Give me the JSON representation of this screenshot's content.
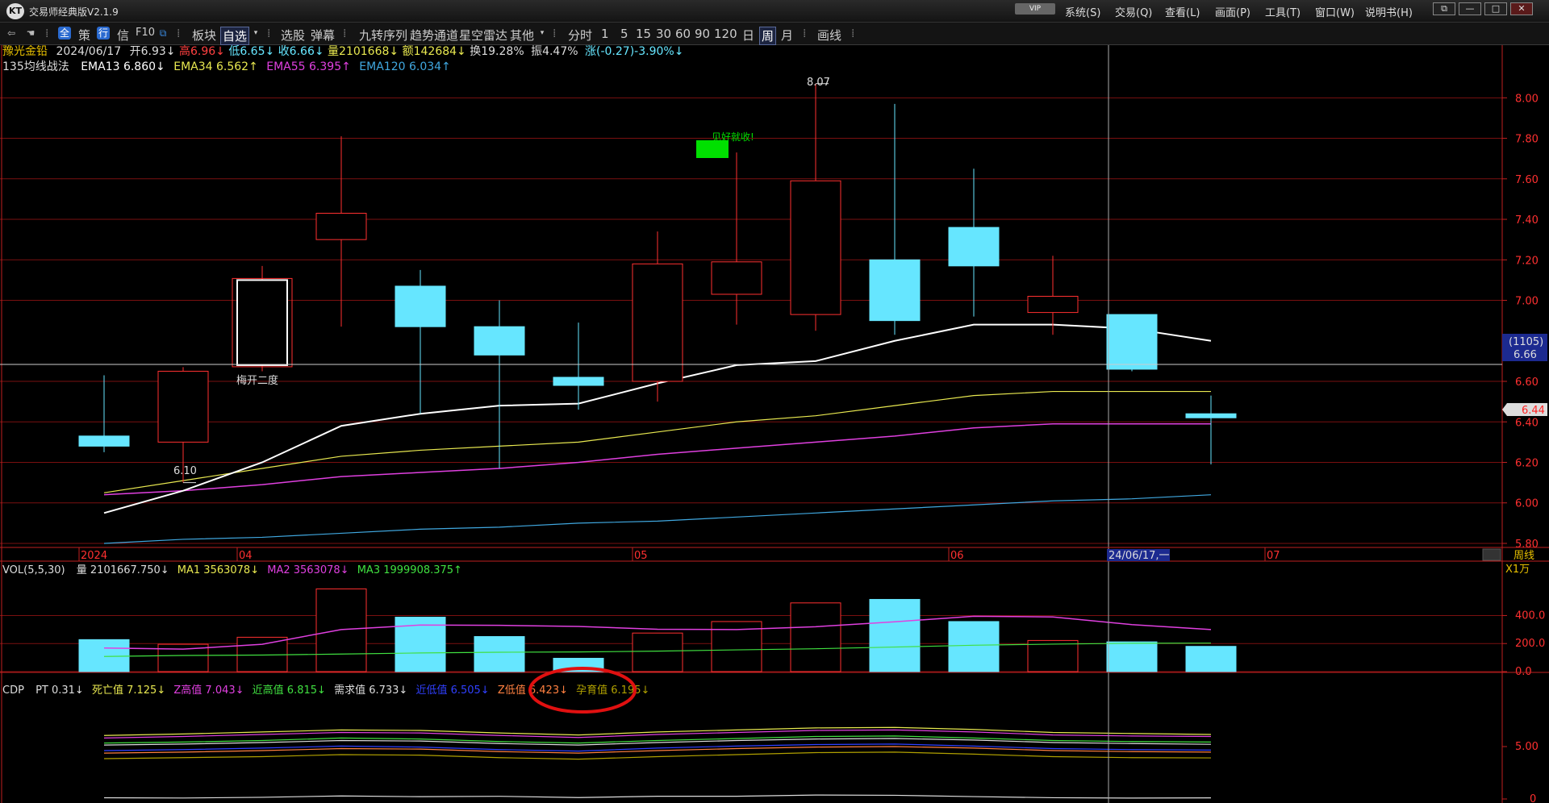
{
  "app": {
    "title": "交易师经典版V2.1.9",
    "logo": "KT",
    "vip": "VIP",
    "menus": [
      "系统(S)",
      "交易(Q)",
      "查看(L)",
      "画面(P)",
      "工具(T)",
      "窗口(W)",
      "说明书(H)"
    ],
    "window_buttons": [
      "⧉",
      "—",
      "□",
      "✕"
    ]
  },
  "toolbar": {
    "icons": [
      "back-arrow-icon",
      "hand-icon"
    ],
    "quanbtn": "全",
    "ce": "策",
    "hang": "行",
    "xin": "信",
    "f10": "F10",
    "items": [
      {
        "label": "板块",
        "active": false
      },
      {
        "label": "自选",
        "active": true,
        "dropdown": true
      },
      {
        "label": "选股",
        "active": false
      },
      {
        "label": "弹幕",
        "active": false
      },
      {
        "label": "九转序列",
        "active": false
      },
      {
        "label": "趋势通道",
        "active": false
      },
      {
        "label": "星空雷达",
        "active": false
      },
      {
        "label": "其他",
        "active": false,
        "dropdown": true
      },
      {
        "label": "分时",
        "active": false
      },
      {
        "label": "1",
        "active": false
      },
      {
        "label": "5",
        "active": false
      },
      {
        "label": "15",
        "active": false
      },
      {
        "label": "30",
        "active": false
      },
      {
        "label": "60",
        "active": false
      },
      {
        "label": "90",
        "active": false
      },
      {
        "label": "120",
        "active": false
      },
      {
        "label": "日",
        "active": false
      },
      {
        "label": "周",
        "active": true
      },
      {
        "label": "月",
        "active": false
      },
      {
        "label": "画线",
        "active": false
      }
    ]
  },
  "quote": {
    "name": "豫光金铅",
    "date": "2024/06/17",
    "open": "开6.93↓",
    "high": "高6.96↓",
    "low": "低6.65↓",
    "close": "收6.66↓",
    "vol": "量2101668↓",
    "amount": "额142684↓",
    "turnover": "换19.28%",
    "amplitude": "振4.47%",
    "change": "涨(-0.27)-3.90%↓"
  },
  "ema_line": {
    "name": "135均线战法",
    "ema13": "EMA13 6.860↓",
    "ema34": "EMA34 6.562↑",
    "ema55": "EMA55 6.395↑",
    "ema120": "EMA120 6.034↑"
  },
  "vol_line": {
    "name": "VOL(5,5,30)",
    "vol": "量 2101667.750↓",
    "ma1": "MA1 3563078↓",
    "ma2": "MA2 3563078↓",
    "ma3": "MA3 1999908.375↑"
  },
  "cdp_line": {
    "name": "CDP",
    "pt": "PT 0.31↓",
    "siwang": "死亡值 7.125↓",
    "zgao": "Z高值 7.043↓",
    "jingao": "近高值 6.815↓",
    "xuqiu": "需求值 6.733↓",
    "jindi": "近低值 6.505↓",
    "zdi": "Z低值 6.423↓",
    "yunyu": "孕育值 6.195↓"
  },
  "annotations": {
    "high_label": "8.07",
    "low_label": "6.10",
    "note_green": "见好就收!",
    "note_white": "梅开二度",
    "crosshair_box": "(1105)",
    "crosshair_price": "6.66",
    "last_price": "6.44",
    "crosshair_date": "24/06/17,一",
    "period": "周线",
    "vol_unit": "X1万"
  },
  "colors": {
    "up": "#ff3030",
    "down": "#66e6ff",
    "ema13": "#ffffff",
    "ema34": "#e8e850",
    "ema55": "#e040e0",
    "ema120": "#40a8e0",
    "grid": "#7a1010",
    "axis": "#c02020"
  },
  "chart_data": [
    {
      "type": "candlestick",
      "title": "豫光金铅 周线",
      "x": [
        "2024-03-11",
        "2024-03-18",
        "2024-03-25",
        "2024-04-01",
        "2024-04-08",
        "2024-04-15",
        "2024-04-22",
        "2024-04-29",
        "2024-05-06",
        "2024-05-13",
        "2024-05-20",
        "2024-05-27",
        "2024-06-03",
        "2024-06-10",
        "2024-06-17"
      ],
      "x_ticks": [
        {
          "i": 0,
          "label": "2024"
        },
        {
          "i": 2,
          "label": "04"
        },
        {
          "i": 7,
          "label": "05"
        },
        {
          "i": 11,
          "label": "06"
        },
        {
          "i": 15,
          "label": "07"
        }
      ],
      "open": [
        6.33,
        6.3,
        6.68,
        7.3,
        7.07,
        6.87,
        6.62,
        6.6,
        7.03,
        6.93,
        7.2,
        7.36,
        6.94,
        6.93,
        6.44
      ],
      "high": [
        6.63,
        6.67,
        7.17,
        7.81,
        7.15,
        7.0,
        6.89,
        7.34,
        7.73,
        8.07,
        7.97,
        7.65,
        7.22,
        6.93,
        6.53
      ],
      "low": [
        6.25,
        6.1,
        6.65,
        6.87,
        6.44,
        6.17,
        6.46,
        6.5,
        6.88,
        6.85,
        6.83,
        6.92,
        6.83,
        6.65,
        6.19
      ],
      "close": [
        6.28,
        6.65,
        7.1,
        7.43,
        6.87,
        6.73,
        6.58,
        7.18,
        7.19,
        7.59,
        6.9,
        7.17,
        7.02,
        6.66,
        6.42
      ],
      "ema13": [
        5.95,
        6.06,
        6.2,
        6.38,
        6.44,
        6.48,
        6.49,
        6.59,
        6.68,
        6.7,
        6.8,
        6.88,
        6.88,
        6.86,
        6.8
      ],
      "ema34": [
        6.05,
        6.11,
        6.17,
        6.23,
        6.26,
        6.28,
        6.3,
        6.35,
        6.4,
        6.43,
        6.48,
        6.53,
        6.55,
        6.55,
        6.55
      ],
      "ema55": [
        6.04,
        6.06,
        6.09,
        6.13,
        6.15,
        6.17,
        6.2,
        6.24,
        6.27,
        6.3,
        6.33,
        6.37,
        6.39,
        6.39,
        6.39
      ],
      "ema120": [
        5.8,
        5.82,
        5.83,
        5.85,
        5.87,
        5.88,
        5.9,
        5.91,
        5.93,
        5.95,
        5.97,
        5.99,
        6.01,
        6.02,
        6.04
      ],
      "ylim": [
        5.78,
        8.26
      ],
      "yticks": [
        5.8,
        6.0,
        6.2,
        6.4,
        6.6,
        7.0,
        7.2,
        7.4,
        7.6,
        7.8,
        8.0
      ]
    },
    {
      "type": "bar",
      "title": "VOL(5,5,30)",
      "unit": "X1万",
      "values": [
        228,
        195,
        245,
        590,
        388,
        250,
        95,
        275,
        357,
        490,
        515,
        357,
        222,
        212,
        180
      ],
      "ma": [
        168,
        160,
        195,
        300,
        332,
        330,
        322,
        302,
        300,
        320,
        355,
        395,
        390,
        335,
        300
      ],
      "ma3": [
        108,
        115,
        118,
        125,
        133,
        138,
        140,
        146,
        155,
        163,
        175,
        188,
        196,
        202,
        203
      ],
      "ylim": [
        0,
        650
      ],
      "yticks": [
        0.0,
        200.0,
        400.0
      ]
    },
    {
      "type": "line",
      "title": "CDP",
      "series_values": {
        "死亡值": [
          7.08,
          7.14,
          7.22,
          7.3,
          7.28,
          7.18,
          7.1,
          7.22,
          7.3,
          7.38,
          7.4,
          7.32,
          7.2,
          7.16,
          7.12
        ],
        "Z高值": [
          6.98,
          7.04,
          7.12,
          7.2,
          7.18,
          7.08,
          7.0,
          7.12,
          7.2,
          7.28,
          7.3,
          7.22,
          7.1,
          7.06,
          7.04
        ],
        "近高值": [
          6.78,
          6.82,
          6.88,
          6.98,
          6.94,
          6.84,
          6.78,
          6.88,
          6.96,
          7.04,
          7.06,
          6.98,
          6.88,
          6.84,
          6.82
        ],
        "需求值": [
          6.7,
          6.74,
          6.8,
          6.88,
          6.86,
          6.76,
          6.7,
          6.8,
          6.88,
          6.94,
          6.96,
          6.9,
          6.8,
          6.76,
          6.73
        ],
        "近低值": [
          6.48,
          6.52,
          6.58,
          6.66,
          6.62,
          6.52,
          6.46,
          6.58,
          6.66,
          6.72,
          6.74,
          6.66,
          6.56,
          6.52,
          6.5
        ],
        "Z低值": [
          6.38,
          6.42,
          6.48,
          6.56,
          6.54,
          6.44,
          6.38,
          6.48,
          6.56,
          6.62,
          6.64,
          6.58,
          6.48,
          6.44,
          6.42
        ],
        "孕育值": [
          6.16,
          6.2,
          6.24,
          6.32,
          6.3,
          6.2,
          6.14,
          6.24,
          6.32,
          6.4,
          6.42,
          6.34,
          6.24,
          6.2,
          6.19
        ]
      },
      "pt": [
        0.38,
        0.3,
        0.52,
        0.94,
        0.71,
        0.83,
        0.43,
        0.84,
        0.85,
        1.22,
        1.14,
        0.73,
        0.39,
        0.28,
        0.34
      ],
      "yticks": [
        0,
        5.0
      ]
    }
  ]
}
